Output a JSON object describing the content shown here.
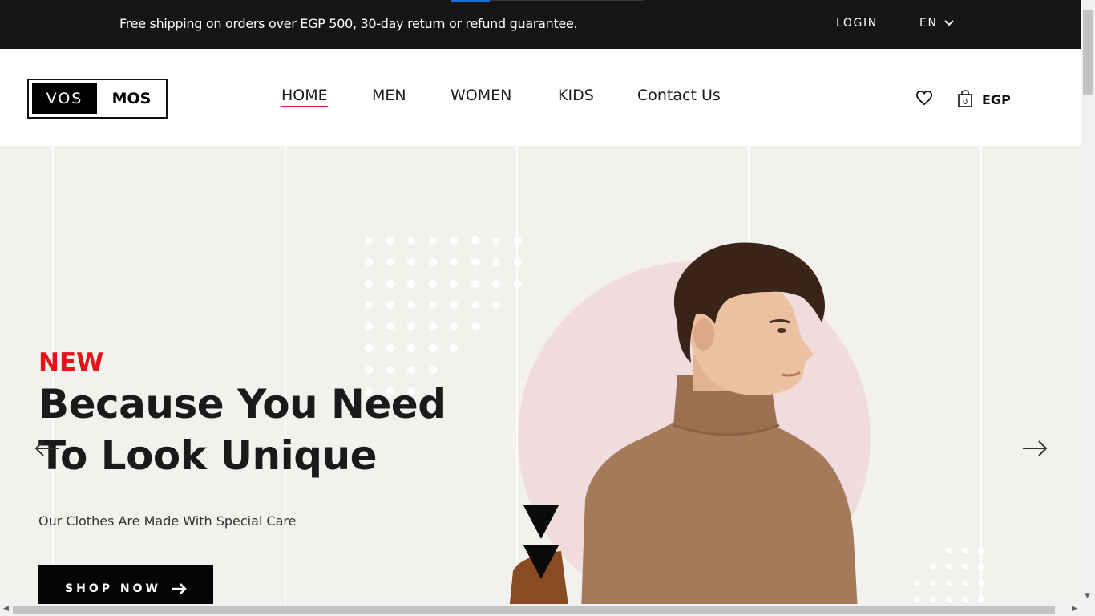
{
  "topbar": {
    "promo": "Free shipping on orders over EGP 500, 30-day return or refund guarantee.",
    "login": "LOGIN",
    "language": "EN"
  },
  "header": {
    "logo_left": "VOS",
    "logo_right": "MOS",
    "nav": [
      "HOME",
      "MEN",
      "WOMEN",
      "KIDS",
      "Contact Us"
    ],
    "active_nav": "HOME",
    "cart_count": "0",
    "currency": "EGP"
  },
  "hero": {
    "tag": "NEW",
    "headline_line1": "Because You Need",
    "headline_line2": "To Look Unique",
    "subtitle": "Our Clothes Are Made With Special Care",
    "cta": "SHOP NOW"
  },
  "colors": {
    "accent": "#e3121b",
    "topbar_bg": "#151515",
    "hero_bg": "#f2f1ee",
    "circle": "#f0dcdc",
    "sweater": "#a47a5a"
  },
  "icons": [
    "chevron-down-icon",
    "heart-icon",
    "shopping-bag-icon",
    "arrow-right-icon",
    "arrow-left-icon"
  ]
}
